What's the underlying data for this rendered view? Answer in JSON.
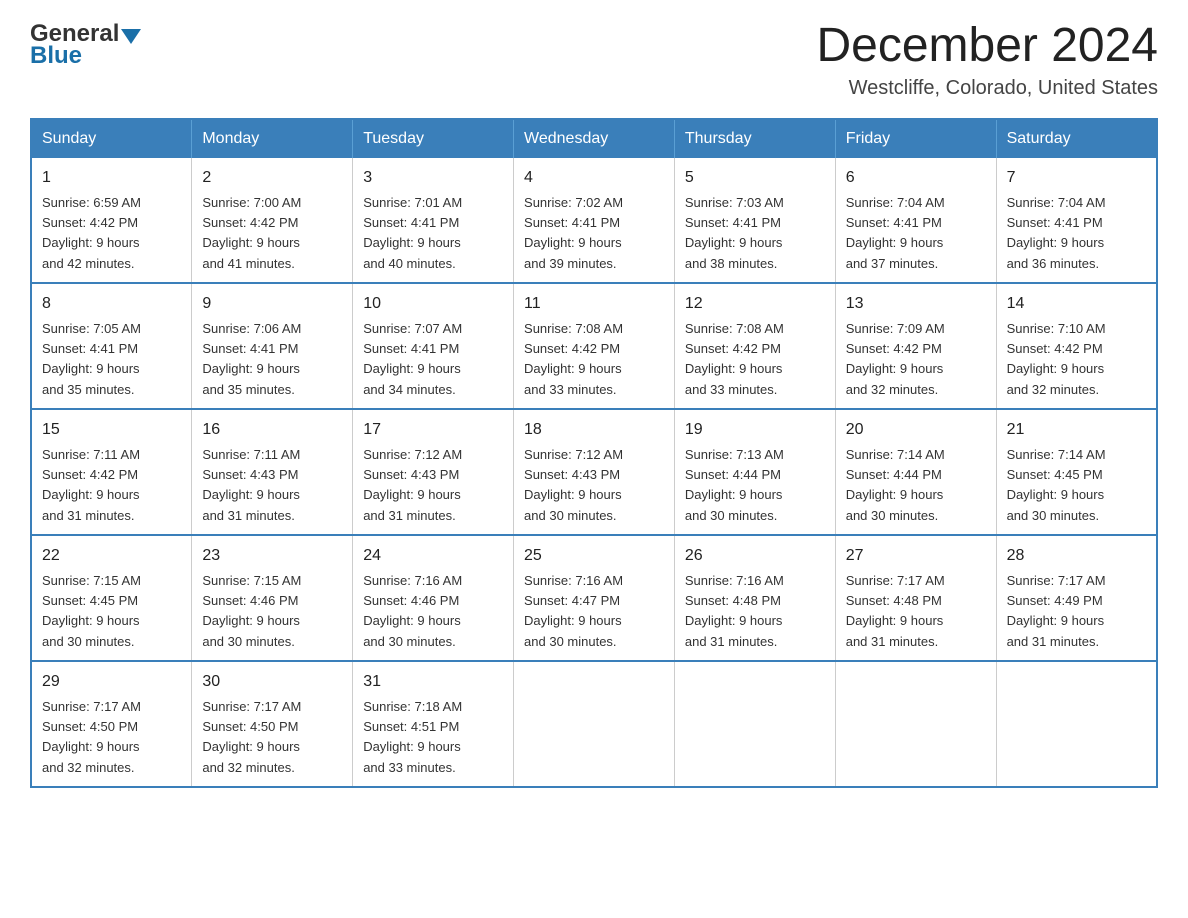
{
  "logo": {
    "general": "General",
    "blue": "Blue",
    "triangle": "▼"
  },
  "title": "December 2024",
  "subtitle": "Westcliffe, Colorado, United States",
  "headers": [
    "Sunday",
    "Monday",
    "Tuesday",
    "Wednesday",
    "Thursday",
    "Friday",
    "Saturday"
  ],
  "weeks": [
    [
      {
        "day": "1",
        "sunrise": "Sunrise: 6:59 AM",
        "sunset": "Sunset: 4:42 PM",
        "daylight": "Daylight: 9 hours",
        "minutes": "and 42 minutes."
      },
      {
        "day": "2",
        "sunrise": "Sunrise: 7:00 AM",
        "sunset": "Sunset: 4:42 PM",
        "daylight": "Daylight: 9 hours",
        "minutes": "and 41 minutes."
      },
      {
        "day": "3",
        "sunrise": "Sunrise: 7:01 AM",
        "sunset": "Sunset: 4:41 PM",
        "daylight": "Daylight: 9 hours",
        "minutes": "and 40 minutes."
      },
      {
        "day": "4",
        "sunrise": "Sunrise: 7:02 AM",
        "sunset": "Sunset: 4:41 PM",
        "daylight": "Daylight: 9 hours",
        "minutes": "and 39 minutes."
      },
      {
        "day": "5",
        "sunrise": "Sunrise: 7:03 AM",
        "sunset": "Sunset: 4:41 PM",
        "daylight": "Daylight: 9 hours",
        "minutes": "and 38 minutes."
      },
      {
        "day": "6",
        "sunrise": "Sunrise: 7:04 AM",
        "sunset": "Sunset: 4:41 PM",
        "daylight": "Daylight: 9 hours",
        "minutes": "and 37 minutes."
      },
      {
        "day": "7",
        "sunrise": "Sunrise: 7:04 AM",
        "sunset": "Sunset: 4:41 PM",
        "daylight": "Daylight: 9 hours",
        "minutes": "and 36 minutes."
      }
    ],
    [
      {
        "day": "8",
        "sunrise": "Sunrise: 7:05 AM",
        "sunset": "Sunset: 4:41 PM",
        "daylight": "Daylight: 9 hours",
        "minutes": "and 35 minutes."
      },
      {
        "day": "9",
        "sunrise": "Sunrise: 7:06 AM",
        "sunset": "Sunset: 4:41 PM",
        "daylight": "Daylight: 9 hours",
        "minutes": "and 35 minutes."
      },
      {
        "day": "10",
        "sunrise": "Sunrise: 7:07 AM",
        "sunset": "Sunset: 4:41 PM",
        "daylight": "Daylight: 9 hours",
        "minutes": "and 34 minutes."
      },
      {
        "day": "11",
        "sunrise": "Sunrise: 7:08 AM",
        "sunset": "Sunset: 4:42 PM",
        "daylight": "Daylight: 9 hours",
        "minutes": "and 33 minutes."
      },
      {
        "day": "12",
        "sunrise": "Sunrise: 7:08 AM",
        "sunset": "Sunset: 4:42 PM",
        "daylight": "Daylight: 9 hours",
        "minutes": "and 33 minutes."
      },
      {
        "day": "13",
        "sunrise": "Sunrise: 7:09 AM",
        "sunset": "Sunset: 4:42 PM",
        "daylight": "Daylight: 9 hours",
        "minutes": "and 32 minutes."
      },
      {
        "day": "14",
        "sunrise": "Sunrise: 7:10 AM",
        "sunset": "Sunset: 4:42 PM",
        "daylight": "Daylight: 9 hours",
        "minutes": "and 32 minutes."
      }
    ],
    [
      {
        "day": "15",
        "sunrise": "Sunrise: 7:11 AM",
        "sunset": "Sunset: 4:42 PM",
        "daylight": "Daylight: 9 hours",
        "minutes": "and 31 minutes."
      },
      {
        "day": "16",
        "sunrise": "Sunrise: 7:11 AM",
        "sunset": "Sunset: 4:43 PM",
        "daylight": "Daylight: 9 hours",
        "minutes": "and 31 minutes."
      },
      {
        "day": "17",
        "sunrise": "Sunrise: 7:12 AM",
        "sunset": "Sunset: 4:43 PM",
        "daylight": "Daylight: 9 hours",
        "minutes": "and 31 minutes."
      },
      {
        "day": "18",
        "sunrise": "Sunrise: 7:12 AM",
        "sunset": "Sunset: 4:43 PM",
        "daylight": "Daylight: 9 hours",
        "minutes": "and 30 minutes."
      },
      {
        "day": "19",
        "sunrise": "Sunrise: 7:13 AM",
        "sunset": "Sunset: 4:44 PM",
        "daylight": "Daylight: 9 hours",
        "minutes": "and 30 minutes."
      },
      {
        "day": "20",
        "sunrise": "Sunrise: 7:14 AM",
        "sunset": "Sunset: 4:44 PM",
        "daylight": "Daylight: 9 hours",
        "minutes": "and 30 minutes."
      },
      {
        "day": "21",
        "sunrise": "Sunrise: 7:14 AM",
        "sunset": "Sunset: 4:45 PM",
        "daylight": "Daylight: 9 hours",
        "minutes": "and 30 minutes."
      }
    ],
    [
      {
        "day": "22",
        "sunrise": "Sunrise: 7:15 AM",
        "sunset": "Sunset: 4:45 PM",
        "daylight": "Daylight: 9 hours",
        "minutes": "and 30 minutes."
      },
      {
        "day": "23",
        "sunrise": "Sunrise: 7:15 AM",
        "sunset": "Sunset: 4:46 PM",
        "daylight": "Daylight: 9 hours",
        "minutes": "and 30 minutes."
      },
      {
        "day": "24",
        "sunrise": "Sunrise: 7:16 AM",
        "sunset": "Sunset: 4:46 PM",
        "daylight": "Daylight: 9 hours",
        "minutes": "and 30 minutes."
      },
      {
        "day": "25",
        "sunrise": "Sunrise: 7:16 AM",
        "sunset": "Sunset: 4:47 PM",
        "daylight": "Daylight: 9 hours",
        "minutes": "and 30 minutes."
      },
      {
        "day": "26",
        "sunrise": "Sunrise: 7:16 AM",
        "sunset": "Sunset: 4:48 PM",
        "daylight": "Daylight: 9 hours",
        "minutes": "and 31 minutes."
      },
      {
        "day": "27",
        "sunrise": "Sunrise: 7:17 AM",
        "sunset": "Sunset: 4:48 PM",
        "daylight": "Daylight: 9 hours",
        "minutes": "and 31 minutes."
      },
      {
        "day": "28",
        "sunrise": "Sunrise: 7:17 AM",
        "sunset": "Sunset: 4:49 PM",
        "daylight": "Daylight: 9 hours",
        "minutes": "and 31 minutes."
      }
    ],
    [
      {
        "day": "29",
        "sunrise": "Sunrise: 7:17 AM",
        "sunset": "Sunset: 4:50 PM",
        "daylight": "Daylight: 9 hours",
        "minutes": "and 32 minutes."
      },
      {
        "day": "30",
        "sunrise": "Sunrise: 7:17 AM",
        "sunset": "Sunset: 4:50 PM",
        "daylight": "Daylight: 9 hours",
        "minutes": "and 32 minutes."
      },
      {
        "day": "31",
        "sunrise": "Sunrise: 7:18 AM",
        "sunset": "Sunset: 4:51 PM",
        "daylight": "Daylight: 9 hours",
        "minutes": "and 33 minutes."
      },
      null,
      null,
      null,
      null
    ]
  ]
}
